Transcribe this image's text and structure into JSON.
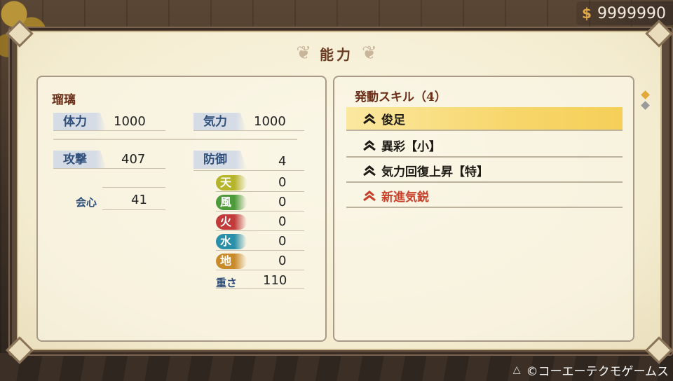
{
  "money": {
    "value": "9999990",
    "icon": "coin-icon"
  },
  "title": "能力",
  "character": {
    "name": "瑠璃",
    "stats": {
      "tairyoku_label": "体力",
      "tairyoku": "1000",
      "kiryoku_label": "気力",
      "kiryoku": "1000",
      "kougeki_label": "攻撃",
      "kougeki": "407",
      "bougyo_label": "防御",
      "bougyo": "4",
      "kaishin_label": "会心",
      "kaishin": "41",
      "omosa_label": "重さ",
      "omosa": "110"
    },
    "elements": [
      {
        "label": "天",
        "value": "0",
        "color": "#b5b42a"
      },
      {
        "label": "風",
        "value": "0",
        "color": "#4c9a3a"
      },
      {
        "label": "火",
        "value": "0",
        "color": "#c23a3a"
      },
      {
        "label": "水",
        "value": "0",
        "color": "#2a8fa8"
      },
      {
        "label": "地",
        "value": "0",
        "color": "#c98a2a"
      }
    ]
  },
  "skills": {
    "header": "発動スキル（4）",
    "items": [
      {
        "name": "俊足",
        "selected": true
      },
      {
        "name": "異彩【小】"
      },
      {
        "name": "気力回復上昇【特】"
      },
      {
        "name": "新進気鋭",
        "highlight": true
      }
    ]
  },
  "footer": {
    "copyright": "©コーエーテクモゲームス"
  },
  "colors": {
    "accent": "#6b2f1a",
    "label_blue": "#2f4e7a",
    "selected": "#f7d66a",
    "red_skill": "#c8402a"
  }
}
